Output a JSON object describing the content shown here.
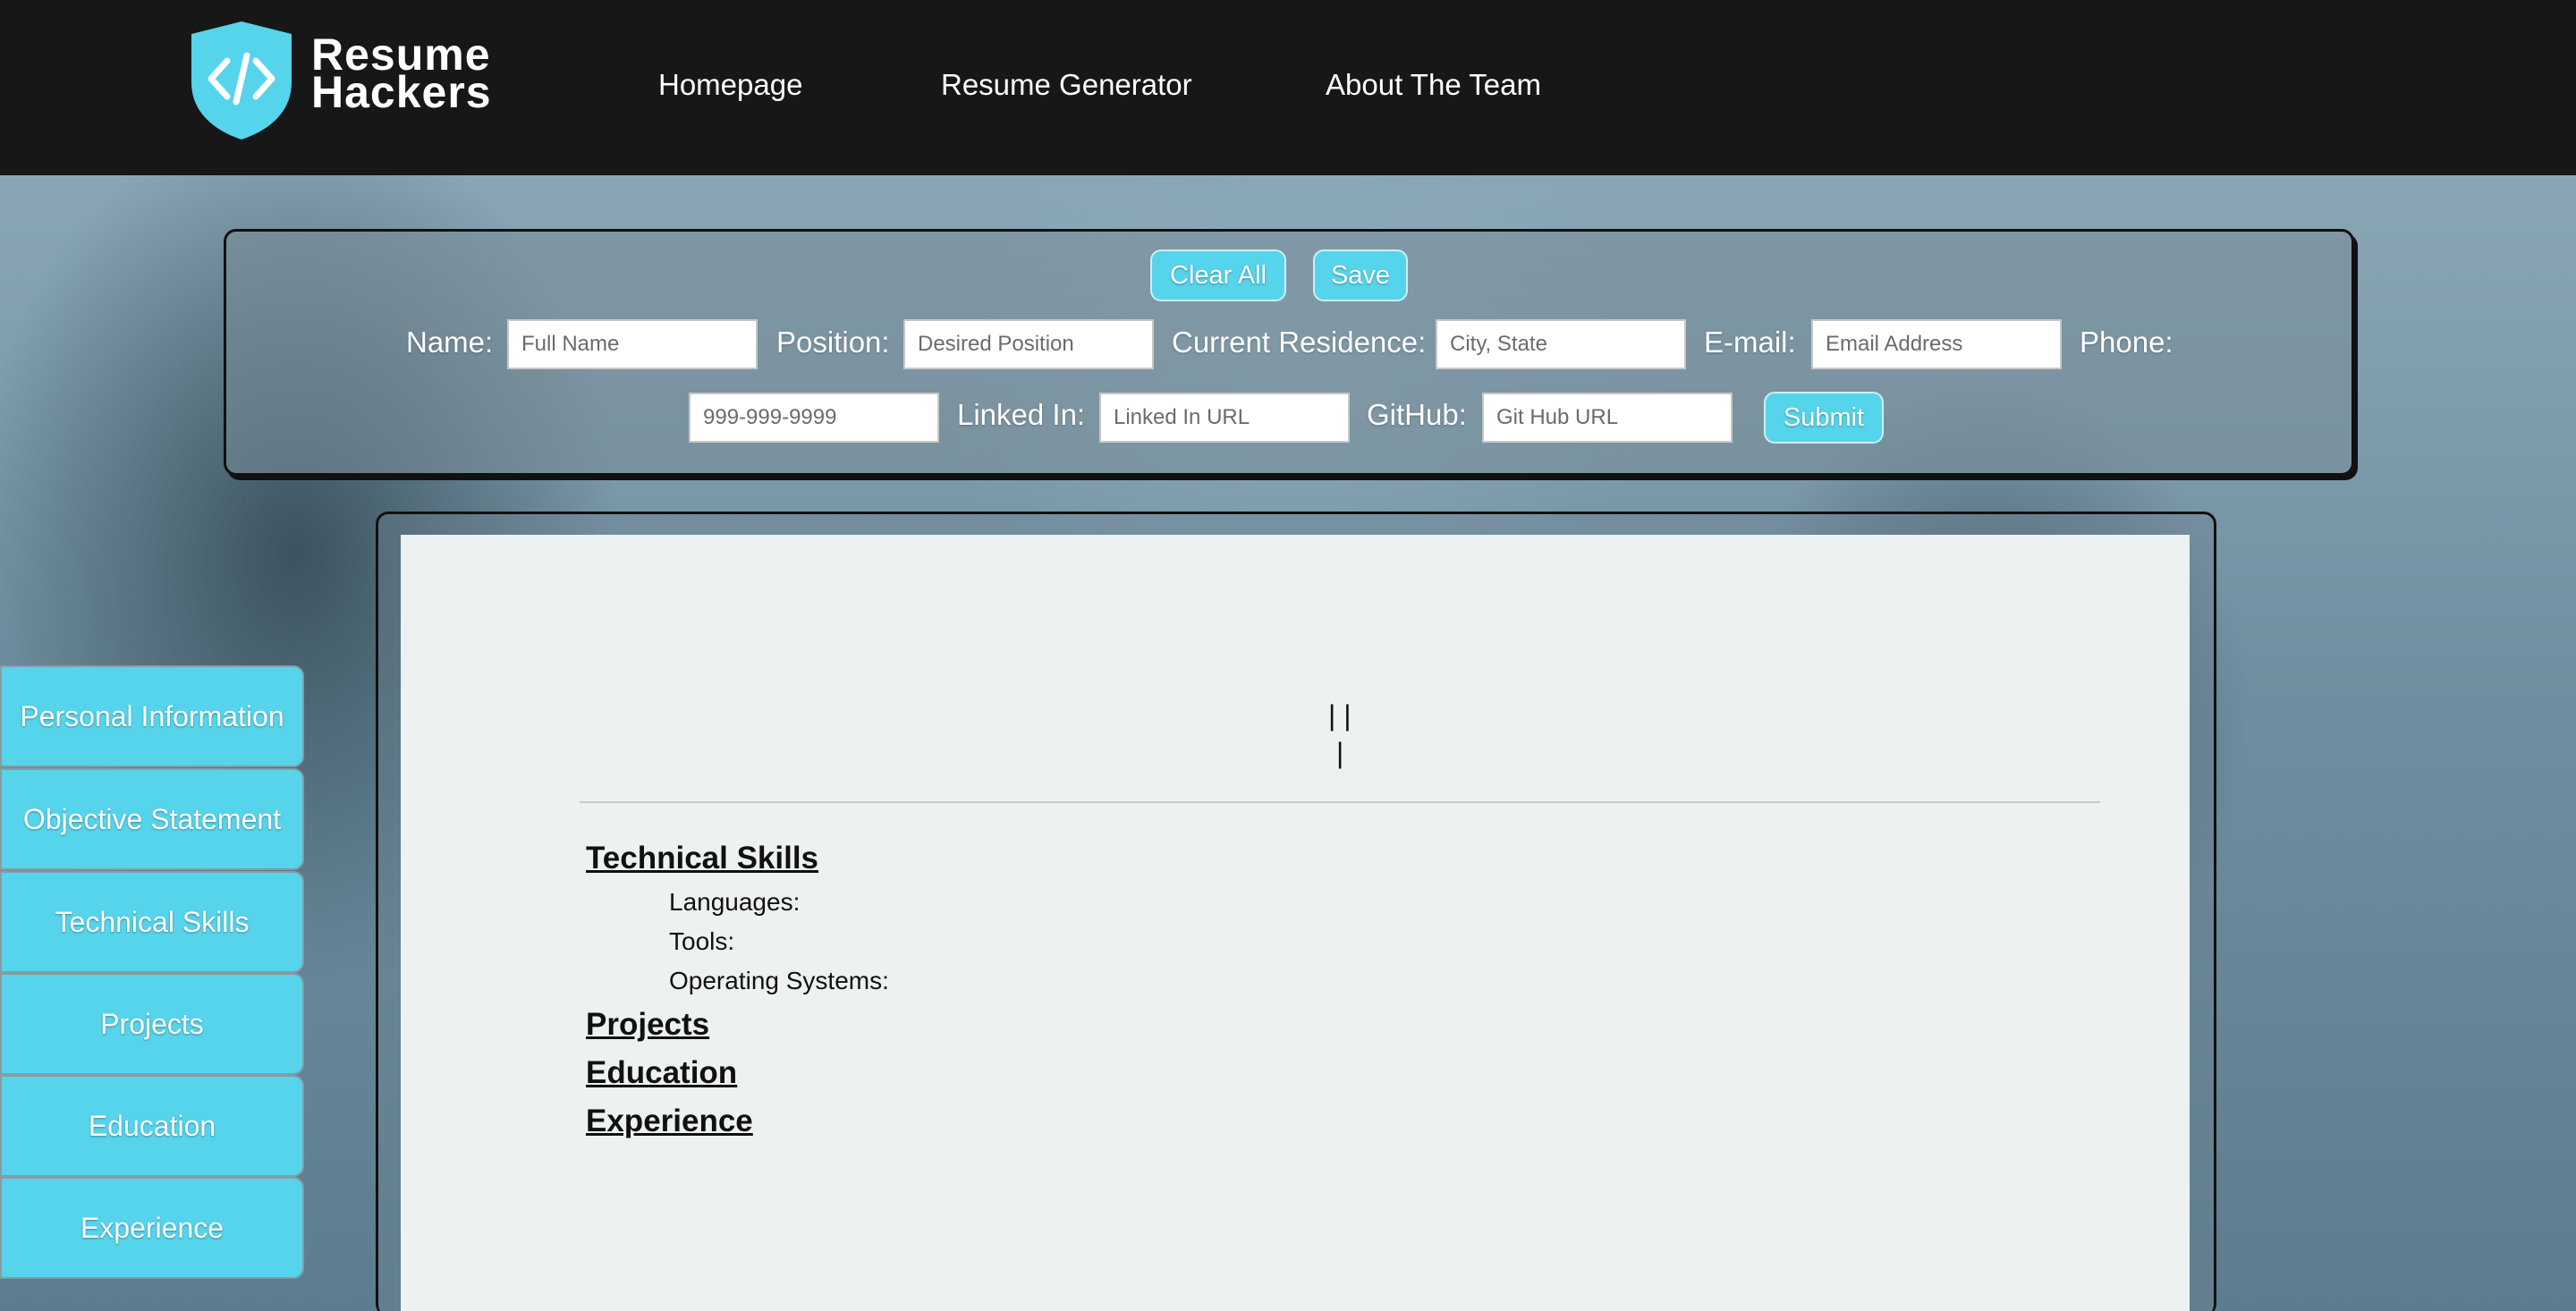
{
  "brand": {
    "line1": "Resume",
    "line2": "Hackers",
    "logo_icon": "code-brackets-shield-icon"
  },
  "nav": [
    "Homepage",
    "Resume Generator",
    "About The Team"
  ],
  "form": {
    "clear_label": "Clear All",
    "save_label": "Save",
    "submit_label": "Submit",
    "name_label": "Name:",
    "name_placeholder": "Full Name",
    "position_label": "Position:",
    "position_placeholder": "Desired Position",
    "residence_label": "Current Residence:",
    "residence_placeholder": "City, State",
    "email_label": "E-mail:",
    "email_placeholder": "Email Address",
    "phone_label": "Phone:",
    "phone_placeholder": "999-999-9999",
    "linkedin_label": "Linked In:",
    "linkedin_placeholder": "Linked In URL",
    "github_label": "GitHub:",
    "github_placeholder": "Git Hub URL"
  },
  "preview": {
    "header_line1": "| |",
    "header_line2": "|",
    "technical_skills": "Technical Skills",
    "languages": "Languages:",
    "tools": "Tools:",
    "operating_systems": "Operating Systems:",
    "projects": "Projects",
    "education": "Education",
    "experience": "Experience"
  },
  "sidebar": [
    "Personal Information",
    "Objective Statement",
    "Technical Skills",
    "Projects",
    "Education",
    "Experience"
  ],
  "colors": {
    "accent": "#56d4ec",
    "header_bg": "#171717",
    "paper": "#edf1f2"
  }
}
